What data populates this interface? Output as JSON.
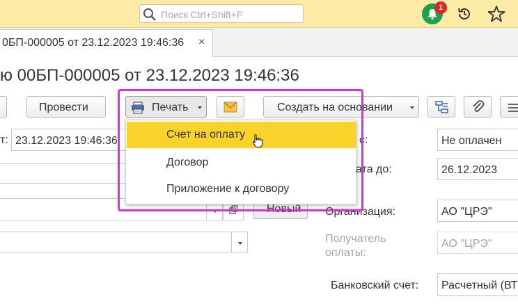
{
  "topbar": {
    "search_placeholder": "Поиск Ctrl+Shift+F",
    "notifications_count": "1"
  },
  "tab": {
    "title": "0БП-000005 от 23.12.2023 19:46:36",
    "close": "×"
  },
  "page_title": "ю 00БП-000005 от 23.12.2023 19:46:36",
  "toolbar": {
    "post_label": "Провести",
    "print_label": "Печать",
    "create_based_label": "Создать на основании"
  },
  "print_menu": {
    "items": [
      "Счет на оплату",
      "Договор",
      "Приложение к договору"
    ],
    "selected_index": 0
  },
  "form": {
    "date_label": "т:",
    "date_value": "23.12.2023 19:46:36",
    "new_button": "Новый",
    "status_label": "с:",
    "status_value": "Не оплачен",
    "pay_until_label": "ата до:",
    "pay_until_value": "26.12.2023",
    "organization_label": "Организация:",
    "organization_value": "АО \"ЦРЭ\"",
    "recipient_label_1": "Получатель",
    "recipient_label_2": "оплаты:",
    "recipient_value": "АО \"ЦРЭ\"",
    "bank_account_label": "Банковский счет:",
    "bank_account_value": "Расчетный (ВТ"
  },
  "colors": {
    "topbar_bg": "#fbeba7",
    "menu_highlight": "#f9d32a",
    "annotation_frame": "#e22bd9",
    "notification_green": "#21a04a",
    "badge_red": "#d9262b"
  }
}
